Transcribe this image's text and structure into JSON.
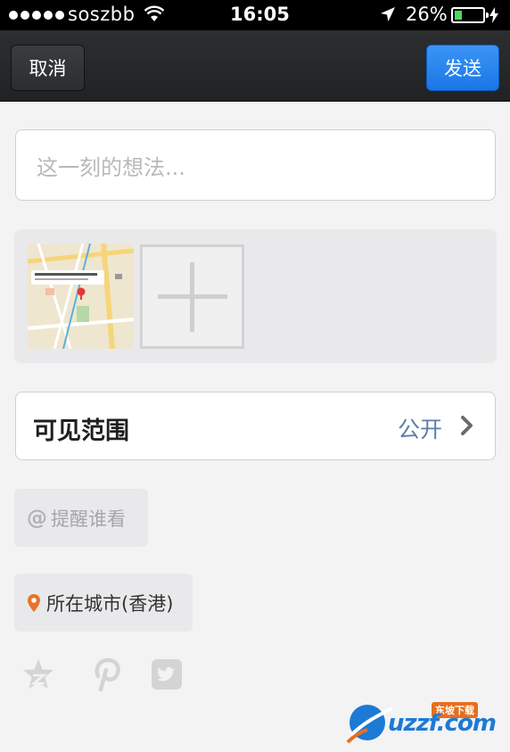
{
  "status_bar": {
    "carrier": "soszbb",
    "time": "16:05",
    "battery_percent": "26%",
    "battery_level": 0.26,
    "battery_color": "#4cd964"
  },
  "nav": {
    "cancel_label": "取消",
    "send_label": "发送",
    "send_color": "#1a76e6"
  },
  "compose": {
    "placeholder": "这一刻的想法..."
  },
  "photos": {
    "items": [
      "map-screenshot"
    ],
    "add_icon": "plus-icon"
  },
  "visibility": {
    "label": "可见范围",
    "value": "公开"
  },
  "mention": {
    "at_symbol": "@",
    "label": "提醒谁看"
  },
  "location": {
    "label": "所在城市(香港)",
    "pin_color": "#e8742a"
  },
  "share_icons": [
    "star-share-icon",
    "pinterest-icon",
    "twitter-icon"
  ],
  "watermark": {
    "brand": "uzzf.com",
    "tagline": "东坡下载"
  }
}
